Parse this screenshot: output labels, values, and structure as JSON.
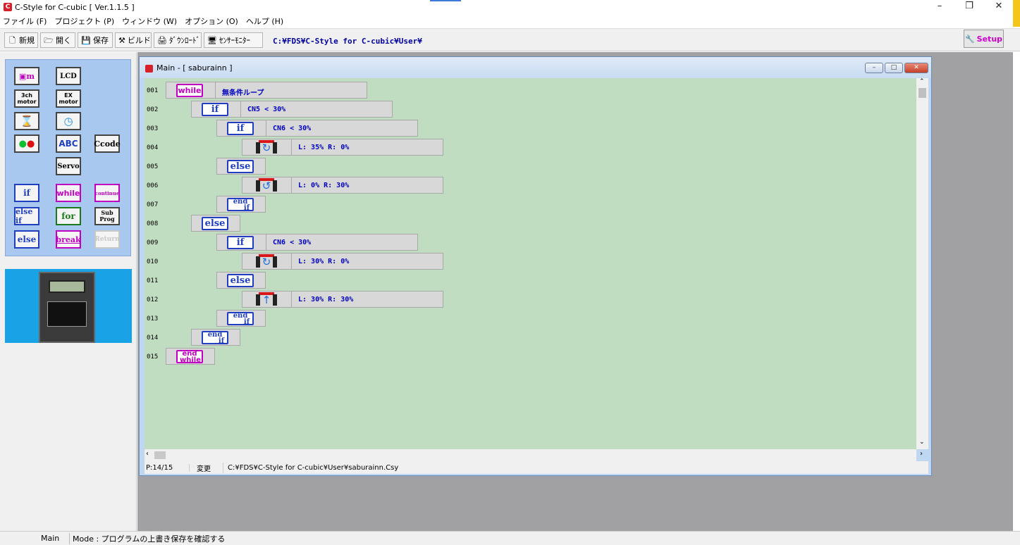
{
  "window": {
    "title": "C-Style for C-cubic  [ Ver.1.1.5 ]"
  },
  "menu": [
    "ファイル (F)",
    "プロジェクト (P)",
    "ウィンドウ (W)",
    "オプション (O)",
    "ヘルプ (H)"
  ],
  "toolbar": {
    "new_label": "新規",
    "open_label": "開く",
    "save_label": "保存",
    "build_label": "ビルド",
    "download_label": "ﾀﾞｳﾝﾛｰﾄﾞ",
    "sensor_label": "ｾﾝｻｰﾓﾆﾀｰ",
    "path": "C:¥FDS¥C-Style for C-cubic¥User¥",
    "setup_label": "Setup"
  },
  "palette": {
    "lcd": "LCD",
    "motor3ch_1": "3ch",
    "motor3ch_2": "motor",
    "exmotor_1": "EX",
    "exmotor_2": "motor",
    "abc": "ABC",
    "ccode": "Ccode",
    "servo": "Servo",
    "if": "if",
    "while": "while",
    "continue": "continue",
    "elseif": "else if",
    "for": "for",
    "subprog_1": "Sub",
    "subprog_2": "Prog",
    "else": "else",
    "break": "break",
    "return": "Return"
  },
  "editor": {
    "title": "Main - [ saburainn ]",
    "rows": [
      {
        "num": "001",
        "kw": "while",
        "text": "無条件ループ"
      },
      {
        "num": "002",
        "kw": "if",
        "text": "CN5 < 30%"
      },
      {
        "num": "003",
        "kw": "if",
        "text": "CN6 < 30%"
      },
      {
        "num": "004",
        "kw": "",
        "text": "L:  35%  R:   0%"
      },
      {
        "num": "005",
        "kw": "else",
        "text": ""
      },
      {
        "num": "006",
        "kw": "",
        "text": "L:   0%  R:  30%"
      },
      {
        "num": "007",
        "kw": "end",
        "text": "if"
      },
      {
        "num": "008",
        "kw": "else",
        "text": ""
      },
      {
        "num": "009",
        "kw": "if",
        "text": "CN6 < 30%"
      },
      {
        "num": "010",
        "kw": "",
        "text": "L:  30%  R:   0%"
      },
      {
        "num": "011",
        "kw": "else",
        "text": ""
      },
      {
        "num": "012",
        "kw": "",
        "text": "L:  30%  R:  30%"
      },
      {
        "num": "013",
        "kw": "end",
        "text": "if"
      },
      {
        "num": "014",
        "kw": "end",
        "text": "if"
      },
      {
        "num": "015",
        "kw": "end",
        "text": "while"
      }
    ],
    "status": {
      "page": "P:14/15",
      "state": "変更",
      "file": "C:¥FDS¥C-Style for C-cubic¥User¥saburainn.Csy"
    }
  },
  "statusbar": {
    "name": "Main",
    "mode": "Mode : プログラムの上書き保存を確認する"
  }
}
